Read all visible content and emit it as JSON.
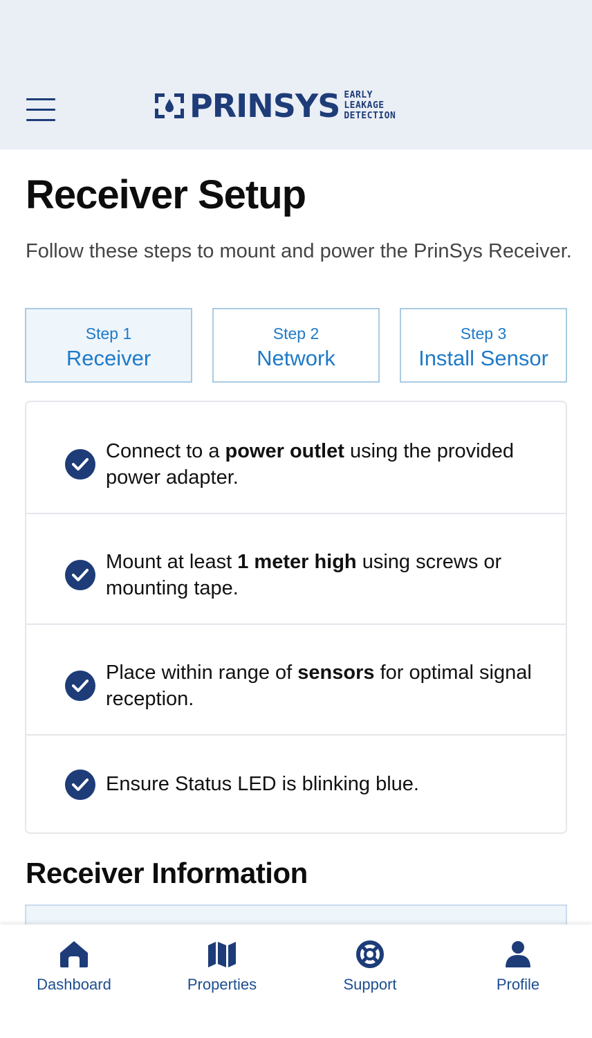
{
  "header": {
    "brand_name": "PRINSYS",
    "brand_tagline": [
      "EARLY",
      "LEAKAGE",
      "DETECTION"
    ]
  },
  "page": {
    "title": "Receiver Setup",
    "intro": "Follow these steps to mount and power the PrinSys Receiver."
  },
  "steps": [
    {
      "number": "Step 1",
      "name": "Receiver",
      "active": true
    },
    {
      "number": "Step 2",
      "name": "Network",
      "active": false
    },
    {
      "number": "Step 3",
      "name": "Install Sensor",
      "active": false
    }
  ],
  "checklist": [
    {
      "before": "Connect to a ",
      "bold": "power outlet",
      "after": " using the provided power adapter."
    },
    {
      "before": "Mount at least ",
      "bold": "1 meter high",
      "after": " using screws or mounting tape."
    },
    {
      "before": "Place within range of ",
      "bold": "sensors",
      "after": " for optimal signal reception."
    },
    {
      "before": "Ensure Status LED is blinking blue.",
      "bold": "",
      "after": ""
    }
  ],
  "info_section": {
    "title": "Receiver Information"
  },
  "tabbar": {
    "items": [
      {
        "label": "Dashboard",
        "icon": "home-icon"
      },
      {
        "label": "Properties",
        "icon": "map-icon"
      },
      {
        "label": "Support",
        "icon": "lifebuoy-icon"
      },
      {
        "label": "Profile",
        "icon": "user-icon"
      }
    ]
  },
  "colors": {
    "brand": "#1d3c78",
    "accent": "#1f7ac8",
    "header_bg": "#eaeef5"
  }
}
